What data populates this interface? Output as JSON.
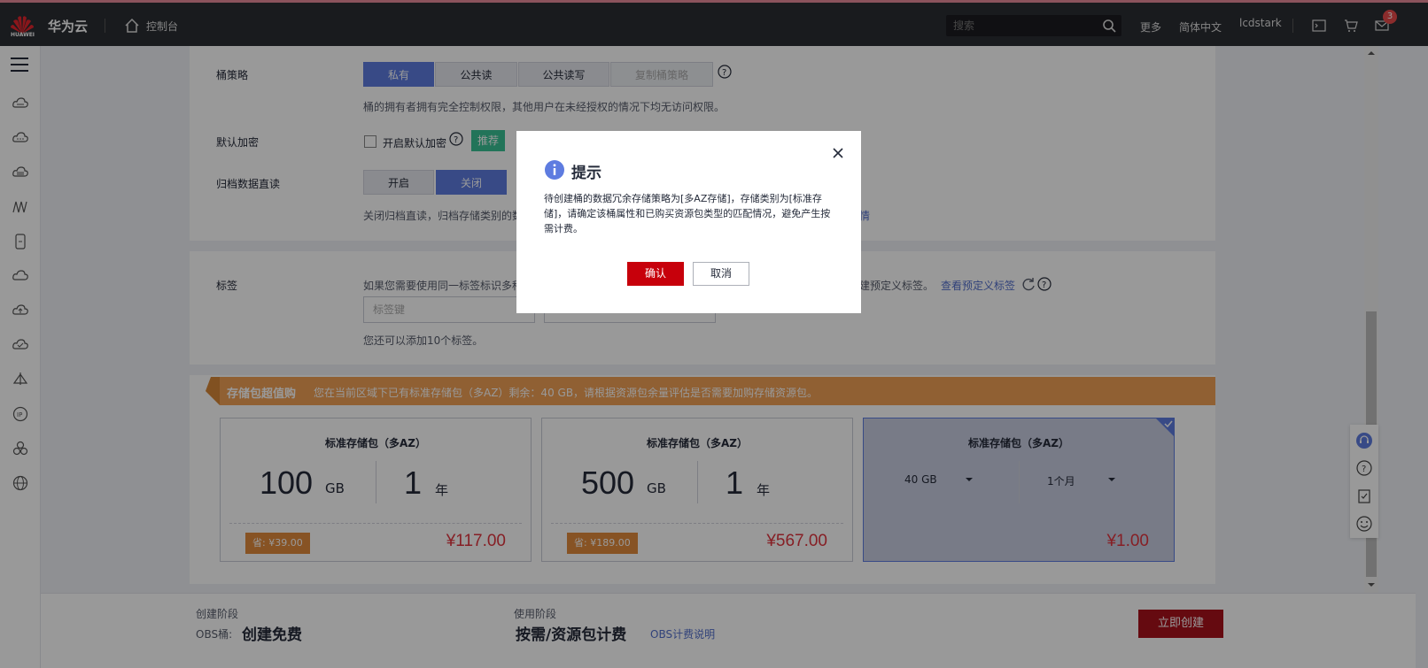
{
  "topbar": {
    "logo_text": "HUAWEI",
    "brand": "华为云",
    "console": "控制台",
    "search_placeholder": "搜索",
    "more": "更多",
    "language": "简体中文",
    "user": "lcdstark",
    "mail_count": "3"
  },
  "form": {
    "bucket_policy_label": "桶策略",
    "policy_options": [
      "私有",
      "公共读",
      "公共读写",
      "复制桶策略"
    ],
    "policy_hint": "桶的拥有者拥有完全控制权限，其他用户在未经授权的情况下均无访问权限。",
    "encryption_label": "默认加密",
    "encryption_checkbox": "开启默认加密",
    "recommend_tag": "推荐",
    "archive_label": "归档数据直读",
    "archive_options": [
      "开启",
      "关闭"
    ],
    "archive_hint": "关闭归档直读，归档存储类别的数",
    "archive_hint_tail": "情",
    "tags_label": "标签",
    "tags_hint": "如果您需要使用同一标签标识多种",
    "tags_hint_tail": "建预定义标签。",
    "view_tags_link": "查看预定义标签",
    "tag_key_placeholder": "标签键",
    "tags_remaining": "您还可以添加10个标签。"
  },
  "promo": {
    "title": "存储包超值购",
    "text": "您在当前区域下已有标准存储包（多AZ）剩余：40 GB，请根据资源包余量评估是否需要加购存储资源包。"
  },
  "packages": [
    {
      "title": "标准存储包（多AZ）",
      "size": "100",
      "size_unit": "GB",
      "duration": "1",
      "duration_unit": "年",
      "save": "省: ¥39.00",
      "price": "¥117.00"
    },
    {
      "title": "标准存储包（多AZ）",
      "size": "500",
      "size_unit": "GB",
      "duration": "1",
      "duration_unit": "年",
      "save": "省: ¥189.00",
      "price": "¥567.00"
    },
    {
      "title": "标准存储包（多AZ）",
      "size_select": "40 GB",
      "duration_select": "1个月",
      "price": "¥1.00"
    }
  ],
  "bottom": {
    "create_stage_label": "创建阶段",
    "obs_bucket_label": "OBS桶:",
    "create_stage_value": "创建免费",
    "use_stage_label": "使用阶段",
    "use_stage_value": "按需/资源包计费",
    "billing_link": "OBS计费说明",
    "create_button": "立即创建"
  },
  "dialog": {
    "title": "提示",
    "message": "待创建桶的数据冗余存储策略为[多AZ存储]，存储类别为[标准存储]，请确定该桶属性和已购买资源包类型的匹配情况，避免产生按需计费。",
    "confirm": "确认",
    "cancel": "取消"
  },
  "colors": {
    "accent": "#5e7ce0",
    "brand_red": "#c7000b",
    "promo": "#f0a055",
    "price": "#e0353f"
  }
}
